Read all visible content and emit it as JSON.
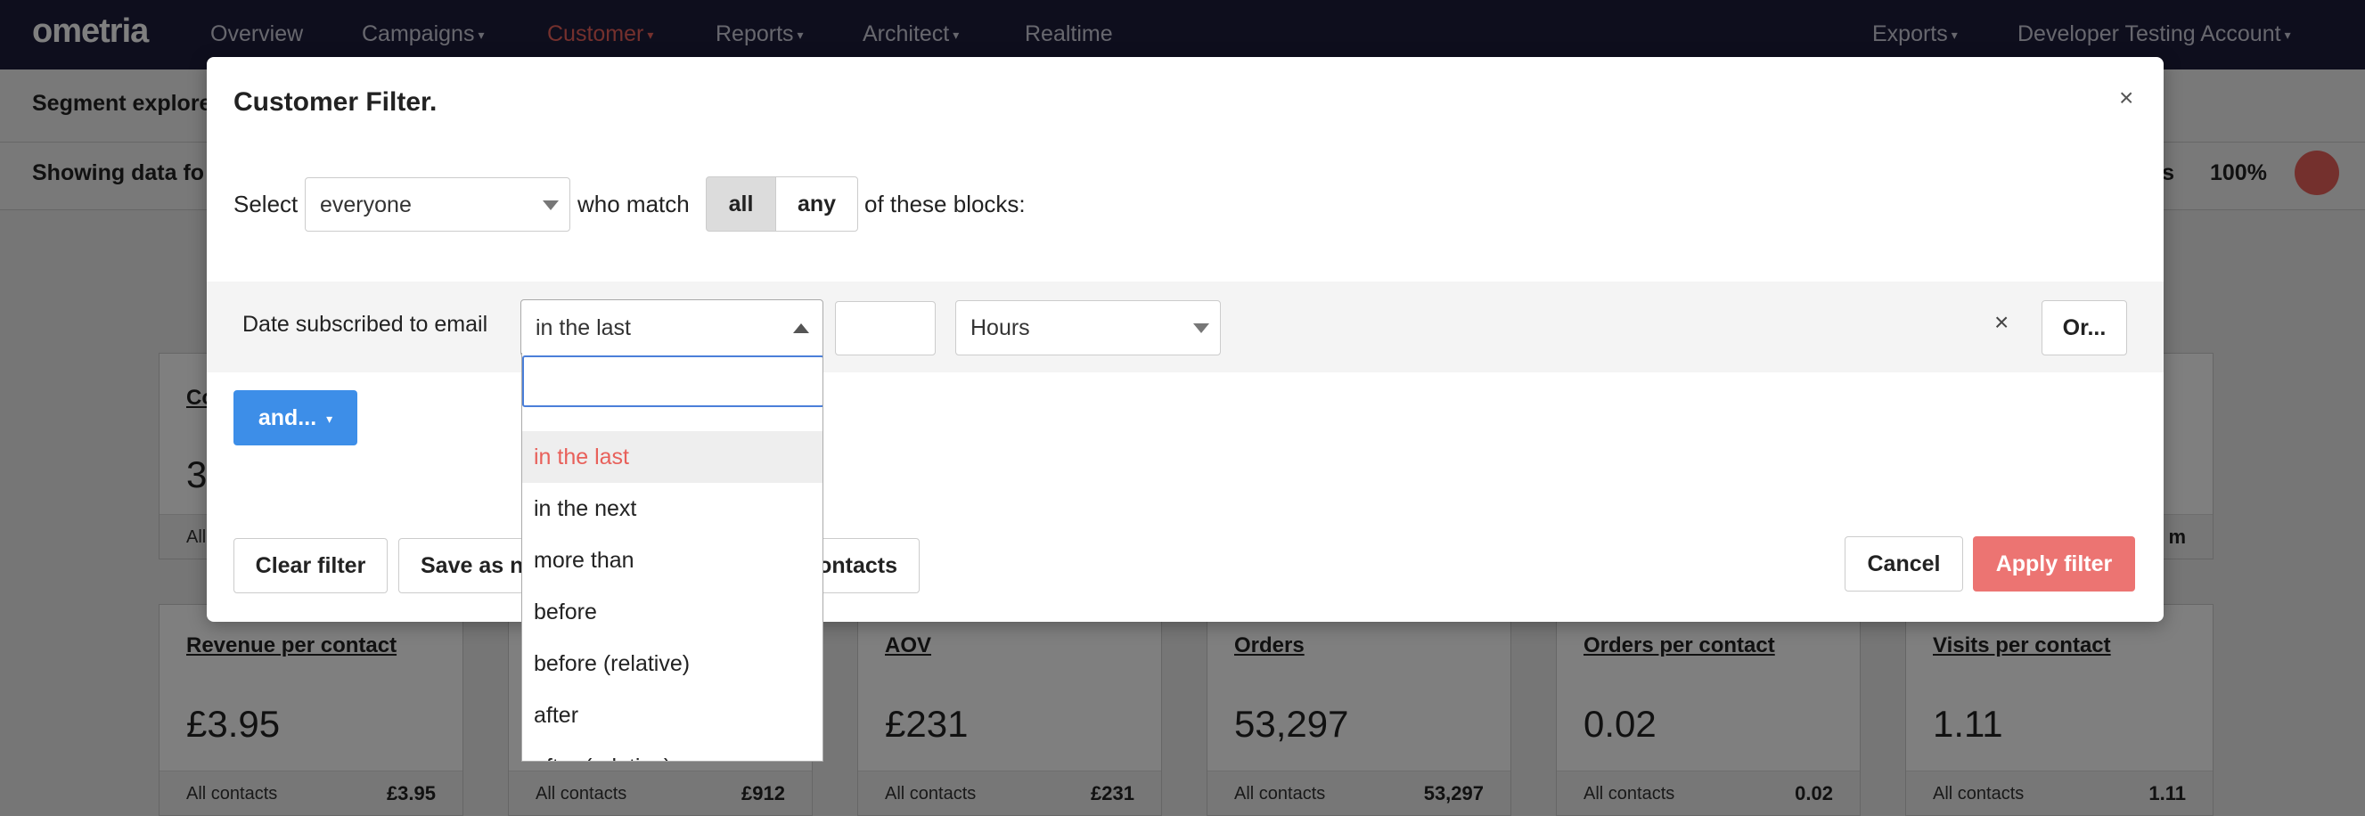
{
  "nav": {
    "logo": "ometria",
    "items": [
      "Overview",
      "Campaigns",
      "Customer",
      "Reports",
      "Architect",
      "Realtime"
    ],
    "right": [
      "Exports",
      "Developer Testing Account"
    ]
  },
  "page": {
    "subtitle": "Segment explore",
    "data_text": "Showing data fo",
    "contacts_text": "acts",
    "contacts_pct": "100%"
  },
  "cards": [
    {
      "title": "Revenue per contact",
      "value": "£3.95",
      "foot_label": "All contacts",
      "foot_value": "£3.95"
    },
    {
      "title": "",
      "value": "",
      "foot_label": "All contacts",
      "foot_value": "£912"
    },
    {
      "title": "AOV",
      "value": "£231",
      "foot_label": "All contacts",
      "foot_value": "£231"
    },
    {
      "title": "Orders",
      "value": "53,297",
      "foot_label": "All contacts",
      "foot_value": "53,297"
    },
    {
      "title": "Orders per contact",
      "value": "0.02",
      "foot_label": "All contacts",
      "foot_value": "0.02"
    },
    {
      "title": "Visits per contact",
      "value": "1.11",
      "foot_label": "All contacts",
      "foot_value": "1.11"
    }
  ],
  "top_cards": {
    "left_title": "Co",
    "left_value": "3",
    "left_foot": "All",
    "right_foot": "m"
  },
  "modal": {
    "title": "Customer Filter.",
    "close": "×",
    "select_label": "Select",
    "select_value": "everyone",
    "match_label": "who match",
    "match_options": [
      "all",
      "any"
    ],
    "blocks_label": "of these blocks:",
    "block": {
      "label": "Date subscribed to email",
      "operator": "in the last",
      "amount": "",
      "unit": "Hours",
      "remove": "×",
      "or_label": "Or..."
    },
    "and_label": "and...",
    "buttons": {
      "clear": "Clear filter",
      "save": "Save as ne",
      "contacts": "ontacts",
      "cancel": "Cancel",
      "apply": "Apply filter"
    }
  },
  "dropdown": {
    "search_value": "",
    "options": [
      "in the last",
      "in the next",
      "more than",
      "before",
      "before (relative)",
      "after",
      "after (relative)"
    ],
    "selected": "in the last"
  },
  "colors": {
    "nav_bg": "#1d1d3a",
    "accent": "#e8605a",
    "primary": "#3d8ee8",
    "apply": "#ec7472"
  }
}
